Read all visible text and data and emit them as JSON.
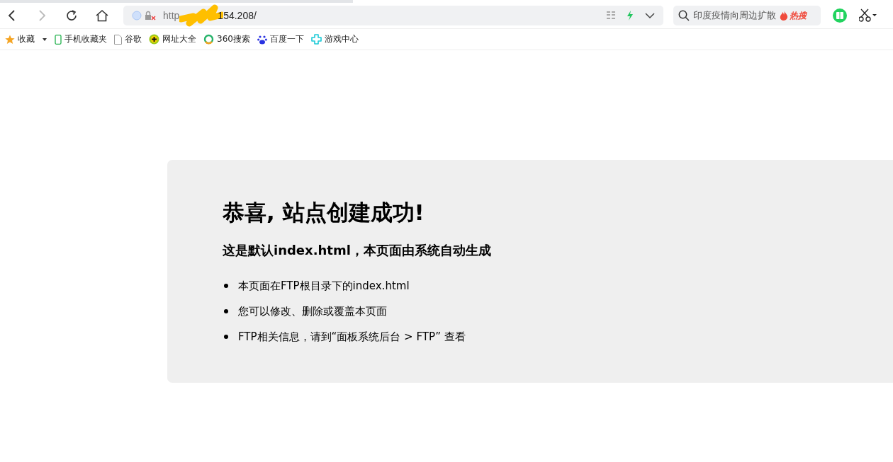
{
  "toolbar": {
    "back_disabled": false,
    "forward_disabled": true,
    "url_start": "http",
    "url_end": "154.208/",
    "search_text": "印度疫情向周边扩散",
    "search_badge": "热搜"
  },
  "bookmarks": [
    {
      "label": "收藏",
      "kind": "star"
    },
    {
      "label": "手机收藏夹",
      "kind": "phone"
    },
    {
      "label": "谷歌",
      "kind": "page"
    },
    {
      "label": "网址大全",
      "kind": "plus"
    },
    {
      "label": "360搜索",
      "kind": "ring"
    },
    {
      "label": "百度一下",
      "kind": "paw"
    },
    {
      "label": "游戏中心",
      "kind": "game"
    }
  ],
  "page": {
    "title": "恭喜, 站点创建成功!",
    "subtitle": "这是默认index.html，本页面由系统自动生成",
    "items": [
      "本页面在FTP根目录下的index.html",
      "您可以修改、删除或覆盖本页面",
      "FTP相关信息，请到“面板系统后台 > FTP” 查看"
    ]
  }
}
